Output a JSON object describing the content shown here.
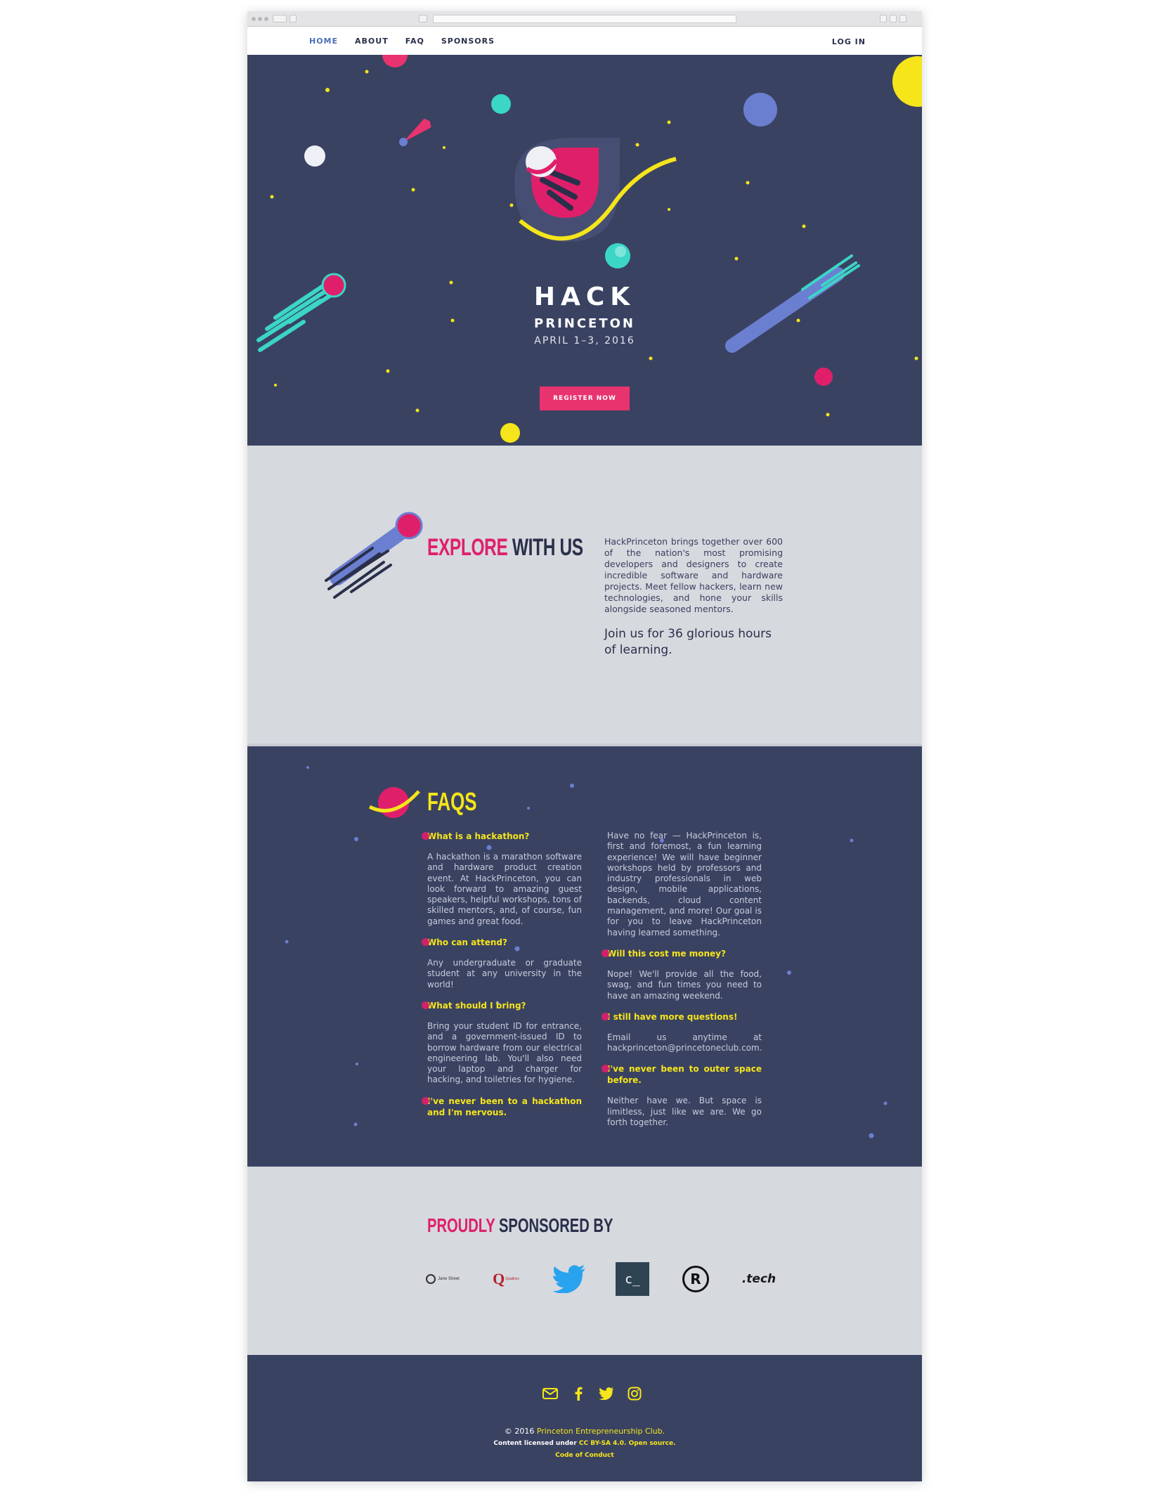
{
  "nav": {
    "links": [
      "HOME",
      "ABOUT",
      "FAQ",
      "SPONSORS"
    ],
    "login": "LOG IN"
  },
  "hero": {
    "title": "HACK",
    "subtitle": "PRINCETON",
    "date": "APRIL 1–3, 2016",
    "register": "REGISTER NOW"
  },
  "explore": {
    "title_highlight": "EXPLORE",
    "title_rest": "WITH US",
    "body": "HackPrinceton brings together over 600 of the nation's most promising developers and designers to create incredible software and hardware projects. Meet fellow hackers, learn new technologies, and hone your skills alongside seasoned mentors.",
    "join": "Join us for 36 glorious hours of learning."
  },
  "faq": {
    "title": "FAQS",
    "col1": [
      {
        "q": "What is a hackathon?",
        "a": "A hackathon is a marathon software and hardware product creation event. At HackPrinceton, you can look forward to amazing guest speakers, helpful workshops, tons of skilled mentors, and, of course, fun games and great food."
      },
      {
        "q": "Who can attend?",
        "a": "Any undergraduate or graduate student at any university in the world!"
      },
      {
        "q": "What should I bring?",
        "a": "Bring your student ID for entrance, and a government-issued ID to borrow hardware from our electrical engineering lab. You'll also need your laptop and charger for hacking, and toiletries for hygiene."
      },
      {
        "q": "I've never been to a hackathon and I'm nervous.",
        "a": ""
      }
    ],
    "col2": [
      {
        "q": "",
        "a": "Have no fear — HackPrinceton is, first and foremost, a fun learning experience! We will have beginner workshops held by professors and industry professionals in web design, mobile applications, backends, cloud content management, and more! Our goal is for you to leave HackPrinceton having learned something."
      },
      {
        "q": "Will this cost me money?",
        "a": "Nope! We'll provide all the food, swag, and fun times you need to have an amazing weekend."
      },
      {
        "q": "I still have more questions!",
        "a": "Email us anytime at hackprinceton@princetoneclub.com."
      },
      {
        "q": "I've never been to outer space before.",
        "a": "Neither have we. But space is limitless, just like we are. We go forth together."
      }
    ]
  },
  "sponsors": {
    "title_highlight": "PROUDLY",
    "title_rest": "SPONSORED BY",
    "logos": [
      "Jane Street",
      "Qualtrics",
      "twitter-bird",
      "c_",
      "R",
      ".tech"
    ]
  },
  "footer": {
    "icons": [
      "mail-icon",
      "facebook-icon",
      "twitter-icon",
      "instagram-icon"
    ],
    "copyright_prefix": "© 2016",
    "copyright_link": "Princeton Entrepreneurship Club.",
    "license_prefix": "Content licensed under",
    "license_link": "CC BY-SA 4.0. Open source.",
    "conduct": "Code of Conduct"
  },
  "colors": {
    "navy": "#3a4262",
    "pink": "#e01f6b",
    "yellow": "#f5e51a",
    "teal": "#3bd6c6",
    "periwinkle": "#6b7fd1"
  }
}
